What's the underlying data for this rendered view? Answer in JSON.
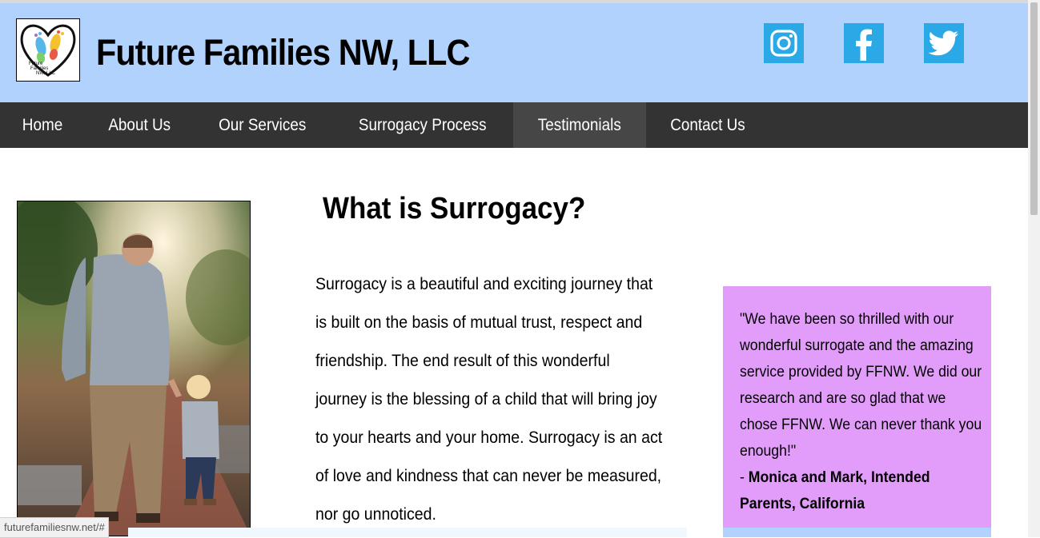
{
  "header": {
    "logo_text": "Future Families NW, LLC",
    "site_title": "Future Families NW, LLC",
    "social": [
      {
        "name": "instagram-icon",
        "label": "Instagram"
      },
      {
        "name": "facebook-icon",
        "label": "Facebook"
      },
      {
        "name": "twitter-icon",
        "label": "Twitter"
      }
    ]
  },
  "nav": {
    "items": [
      {
        "label": "Home"
      },
      {
        "label": "About Us"
      },
      {
        "label": "Our Services"
      },
      {
        "label": "Surrogacy Process"
      },
      {
        "label": "Testimonials",
        "active": true
      },
      {
        "label": "Contact Us"
      }
    ]
  },
  "main": {
    "heading": "What is Surrogacy?",
    "intro": "Surrogacy is a beautiful and exciting journey that is built on the basis of mutual trust, respect and friendship. The end result of this wonderful journey is the blessing of a child that will bring joy to your hearts and your home. Surrogacy is an act of love and kindness that can never be measured, nor go unnoticed."
  },
  "testimonial": {
    "quote": "\"We have been so thrilled with our wonderful surrogate and the amazing service provided by FFNW. We did our research and are so glad that we chose FFNW. We can never thank you enough!\"",
    "author_prefix": "- ",
    "author": "Monica and Mark, Intended Parents, California"
  },
  "status_bar": {
    "url": "futurefamiliesnw.net/#"
  },
  "colors": {
    "header_bg": "#b0d2fc",
    "nav_bg": "#333333",
    "nav_active_bg": "#464646",
    "social_bg": "#2ba8e6",
    "testimonial_bg": "#e29cfa"
  }
}
